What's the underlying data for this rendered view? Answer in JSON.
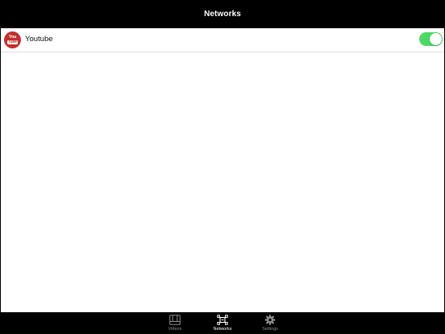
{
  "navbar": {
    "title": "Networks"
  },
  "networks": {
    "items": [
      {
        "label": "Youtube",
        "icon": "youtube-icon",
        "logo_text_top": "You",
        "logo_text_bottom": "Tube",
        "enabled": true
      }
    ]
  },
  "tabbar": {
    "tabs": [
      {
        "label": "Videos",
        "icon": "film-icon",
        "active": false
      },
      {
        "label": "Networks",
        "icon": "networks-icon",
        "active": true
      },
      {
        "label": "Settings",
        "icon": "gear-icon",
        "active": false
      }
    ]
  },
  "colors": {
    "toggle_on": "#4cd964",
    "youtube_red": "#c4302b",
    "bar_background": "#000000",
    "inactive_tab": "#8e8e93"
  }
}
